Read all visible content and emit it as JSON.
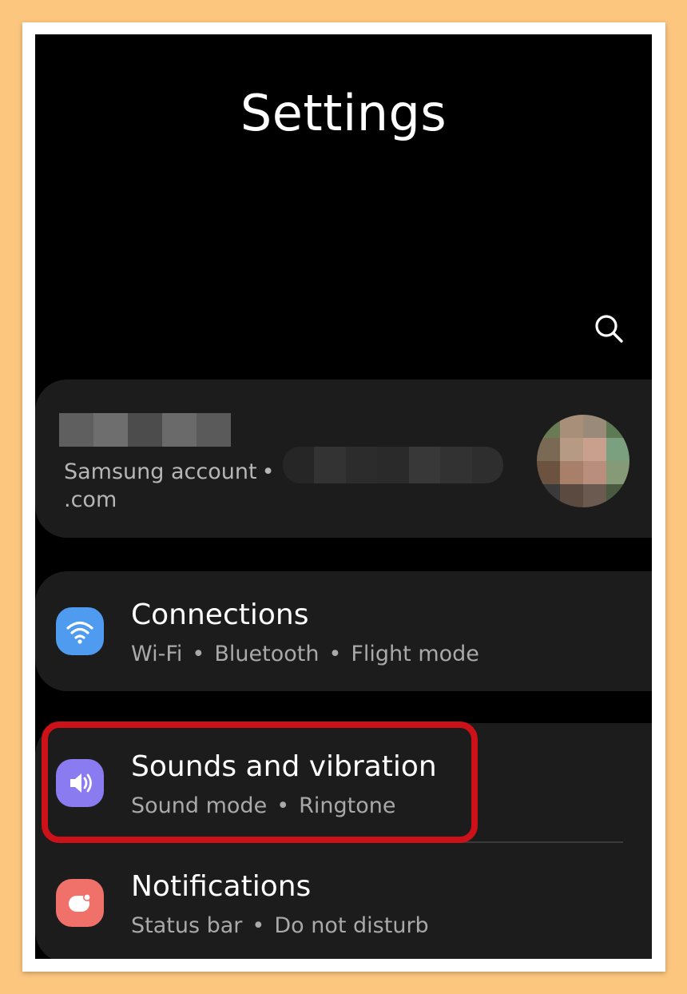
{
  "header": {
    "title": "Settings"
  },
  "account": {
    "label": "Samsung account",
    "separator": "•",
    "email_suffix": ".com"
  },
  "menu": [
    {
      "id": "connections",
      "title": "Connections",
      "subtitle": [
        "Wi-Fi",
        "Bluetooth",
        "Flight mode"
      ],
      "icon": "wifi-icon",
      "color": "#4e9bf0"
    },
    {
      "id": "sounds",
      "title": "Sounds and vibration",
      "subtitle": [
        "Sound mode",
        "Ringtone"
      ],
      "icon": "speaker-icon",
      "color": "#8a7cf0"
    },
    {
      "id": "notifications",
      "title": "Notifications",
      "subtitle": [
        "Status bar",
        "Do not disturb"
      ],
      "icon": "notification-icon",
      "color": "#f0706a"
    }
  ],
  "highlight": {
    "target": "sounds",
    "color": "#cc1119"
  }
}
